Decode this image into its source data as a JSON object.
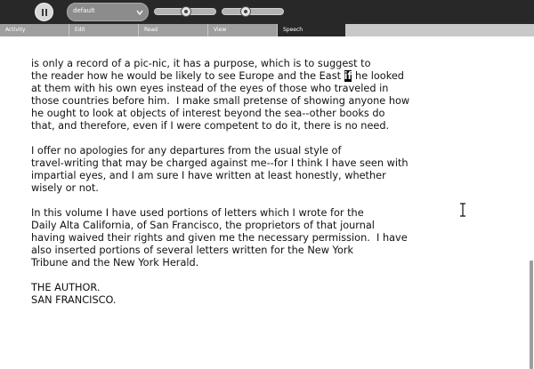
{
  "toolbar": {
    "pause_icon": "pause-icon",
    "voice_select": {
      "value": "default",
      "icon": "chevron-down-icon"
    },
    "pitch_level": 0.5,
    "rate_level": 0.35
  },
  "tabs": [
    {
      "label": "Activity",
      "active": false
    },
    {
      "label": "Edit",
      "active": false
    },
    {
      "label": "Read",
      "active": false
    },
    {
      "label": "View",
      "active": false
    },
    {
      "label": "Speech",
      "active": true
    }
  ],
  "document": {
    "paragraphs": [
      [
        "is only a record of a pic-nic, it has a purpose, which is to suggest to",
        [
          "the reader how he would be likely to see Europe and the East ",
          "if",
          " he looked"
        ],
        "at them with his own eyes instead of the eyes of those who traveled in",
        "those countries before him.  I make small pretense of showing anyone how",
        "he ought to look at objects of interest beyond the sea--other books do",
        "that, and therefore, even if I were competent to do it, there is no need."
      ],
      [
        "I offer no apologies for any departures from the usual style of",
        "travel-writing that may be charged against me--for I think I have seen with",
        "impartial eyes, and I am sure I have written at least honestly, whether",
        "wisely or not."
      ],
      [
        "In this volume I have used portions of letters which I wrote for the",
        "Daily Alta California, of San Francisco, the proprietors of that journal",
        "having waived their rights and given me the necessary permission.  I have",
        "also inserted portions of several letters written for the New York",
        "Tribune and the New York Herald."
      ],
      [
        "THE AUTHOR.",
        "SAN FRANCISCO."
      ]
    ],
    "highlighted_word": "if"
  },
  "cursor": "i-beam-cursor-icon"
}
